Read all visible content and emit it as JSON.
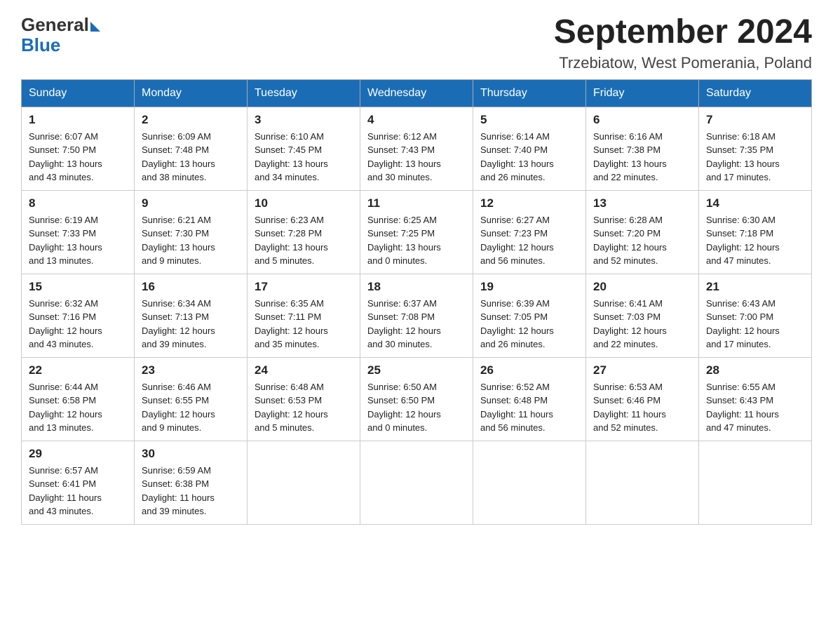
{
  "header": {
    "logo_general": "General",
    "logo_blue": "Blue",
    "title": "September 2024",
    "subtitle": "Trzebiatow, West Pomerania, Poland"
  },
  "days_of_week": [
    "Sunday",
    "Monday",
    "Tuesday",
    "Wednesday",
    "Thursday",
    "Friday",
    "Saturday"
  ],
  "weeks": [
    [
      {
        "day": "1",
        "sunrise": "6:07 AM",
        "sunset": "7:50 PM",
        "daylight": "13 hours and 43 minutes."
      },
      {
        "day": "2",
        "sunrise": "6:09 AM",
        "sunset": "7:48 PM",
        "daylight": "13 hours and 38 minutes."
      },
      {
        "day": "3",
        "sunrise": "6:10 AM",
        "sunset": "7:45 PM",
        "daylight": "13 hours and 34 minutes."
      },
      {
        "day": "4",
        "sunrise": "6:12 AM",
        "sunset": "7:43 PM",
        "daylight": "13 hours and 30 minutes."
      },
      {
        "day": "5",
        "sunrise": "6:14 AM",
        "sunset": "7:40 PM",
        "daylight": "13 hours and 26 minutes."
      },
      {
        "day": "6",
        "sunrise": "6:16 AM",
        "sunset": "7:38 PM",
        "daylight": "13 hours and 22 minutes."
      },
      {
        "day": "7",
        "sunrise": "6:18 AM",
        "sunset": "7:35 PM",
        "daylight": "13 hours and 17 minutes."
      }
    ],
    [
      {
        "day": "8",
        "sunrise": "6:19 AM",
        "sunset": "7:33 PM",
        "daylight": "13 hours and 13 minutes."
      },
      {
        "day": "9",
        "sunrise": "6:21 AM",
        "sunset": "7:30 PM",
        "daylight": "13 hours and 9 minutes."
      },
      {
        "day": "10",
        "sunrise": "6:23 AM",
        "sunset": "7:28 PM",
        "daylight": "13 hours and 5 minutes."
      },
      {
        "day": "11",
        "sunrise": "6:25 AM",
        "sunset": "7:25 PM",
        "daylight": "13 hours and 0 minutes."
      },
      {
        "day": "12",
        "sunrise": "6:27 AM",
        "sunset": "7:23 PM",
        "daylight": "12 hours and 56 minutes."
      },
      {
        "day": "13",
        "sunrise": "6:28 AM",
        "sunset": "7:20 PM",
        "daylight": "12 hours and 52 minutes."
      },
      {
        "day": "14",
        "sunrise": "6:30 AM",
        "sunset": "7:18 PM",
        "daylight": "12 hours and 47 minutes."
      }
    ],
    [
      {
        "day": "15",
        "sunrise": "6:32 AM",
        "sunset": "7:16 PM",
        "daylight": "12 hours and 43 minutes."
      },
      {
        "day": "16",
        "sunrise": "6:34 AM",
        "sunset": "7:13 PM",
        "daylight": "12 hours and 39 minutes."
      },
      {
        "day": "17",
        "sunrise": "6:35 AM",
        "sunset": "7:11 PM",
        "daylight": "12 hours and 35 minutes."
      },
      {
        "day": "18",
        "sunrise": "6:37 AM",
        "sunset": "7:08 PM",
        "daylight": "12 hours and 30 minutes."
      },
      {
        "day": "19",
        "sunrise": "6:39 AM",
        "sunset": "7:05 PM",
        "daylight": "12 hours and 26 minutes."
      },
      {
        "day": "20",
        "sunrise": "6:41 AM",
        "sunset": "7:03 PM",
        "daylight": "12 hours and 22 minutes."
      },
      {
        "day": "21",
        "sunrise": "6:43 AM",
        "sunset": "7:00 PM",
        "daylight": "12 hours and 17 minutes."
      }
    ],
    [
      {
        "day": "22",
        "sunrise": "6:44 AM",
        "sunset": "6:58 PM",
        "daylight": "12 hours and 13 minutes."
      },
      {
        "day": "23",
        "sunrise": "6:46 AM",
        "sunset": "6:55 PM",
        "daylight": "12 hours and 9 minutes."
      },
      {
        "day": "24",
        "sunrise": "6:48 AM",
        "sunset": "6:53 PM",
        "daylight": "12 hours and 5 minutes."
      },
      {
        "day": "25",
        "sunrise": "6:50 AM",
        "sunset": "6:50 PM",
        "daylight": "12 hours and 0 minutes."
      },
      {
        "day": "26",
        "sunrise": "6:52 AM",
        "sunset": "6:48 PM",
        "daylight": "11 hours and 56 minutes."
      },
      {
        "day": "27",
        "sunrise": "6:53 AM",
        "sunset": "6:46 PM",
        "daylight": "11 hours and 52 minutes."
      },
      {
        "day": "28",
        "sunrise": "6:55 AM",
        "sunset": "6:43 PM",
        "daylight": "11 hours and 47 minutes."
      }
    ],
    [
      {
        "day": "29",
        "sunrise": "6:57 AM",
        "sunset": "6:41 PM",
        "daylight": "11 hours and 43 minutes."
      },
      {
        "day": "30",
        "sunrise": "6:59 AM",
        "sunset": "6:38 PM",
        "daylight": "11 hours and 39 minutes."
      },
      null,
      null,
      null,
      null,
      null
    ]
  ],
  "labels": {
    "sunrise": "Sunrise:",
    "sunset": "Sunset:",
    "daylight": "Daylight:"
  }
}
